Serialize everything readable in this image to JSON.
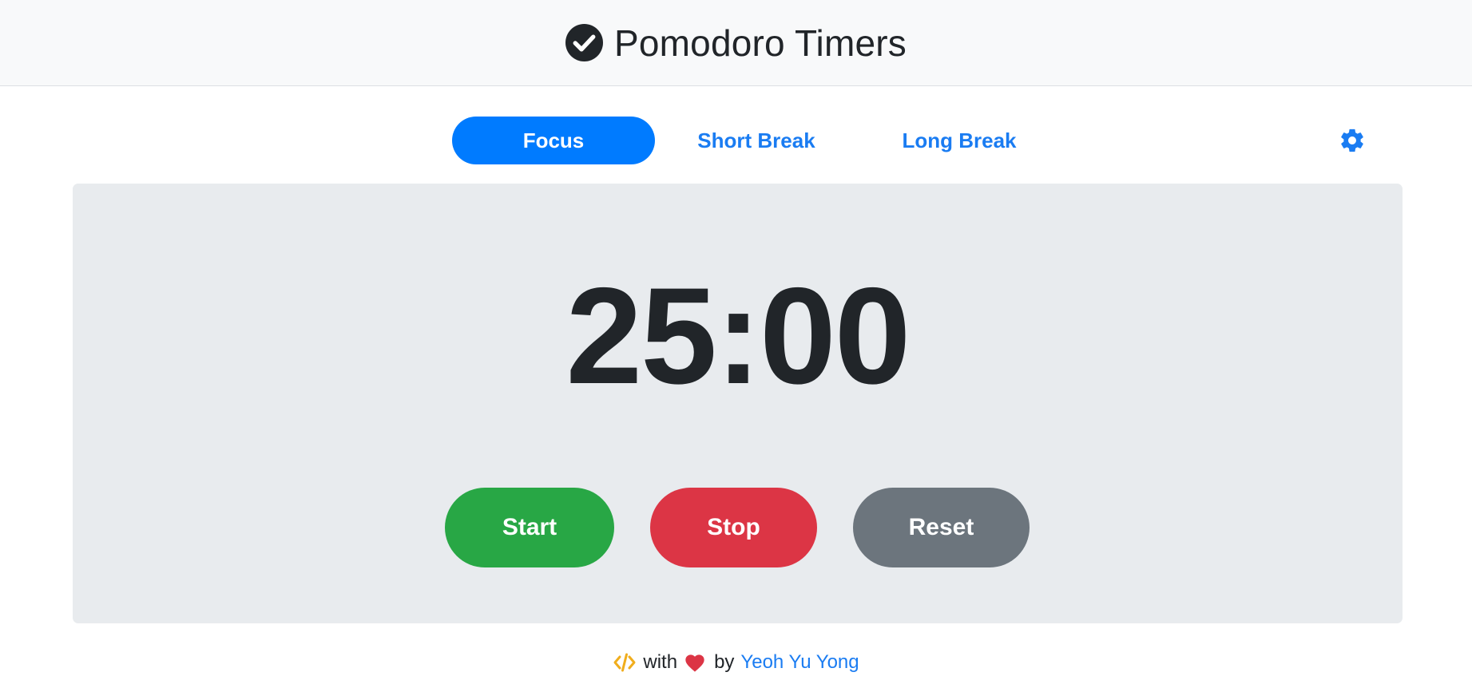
{
  "header": {
    "title": "Pomodoro Timers",
    "icon": "check-circle-icon"
  },
  "tabs": [
    {
      "label": "Focus",
      "active": true
    },
    {
      "label": "Short Break",
      "active": false
    },
    {
      "label": "Long Break",
      "active": false
    }
  ],
  "settings": {
    "icon": "gear-icon"
  },
  "timer": {
    "time": "25:00"
  },
  "controls": {
    "start_label": "Start",
    "stop_label": "Stop",
    "reset_label": "Reset"
  },
  "footer": {
    "code_icon": "code-icon",
    "with_text": "with",
    "heart_icon": "heart-icon",
    "by_text": "by",
    "author": "Yeoh Yu Yong"
  },
  "colors": {
    "primary": "#007bff",
    "link": "#1a7cf2",
    "start": "#28a745",
    "stop": "#dc3545",
    "reset": "#6c757d",
    "card_bg": "#e8ebee",
    "header_bg": "#f8f9fa",
    "code_icon": "#f0ad1c",
    "heart": "#dc3545"
  }
}
